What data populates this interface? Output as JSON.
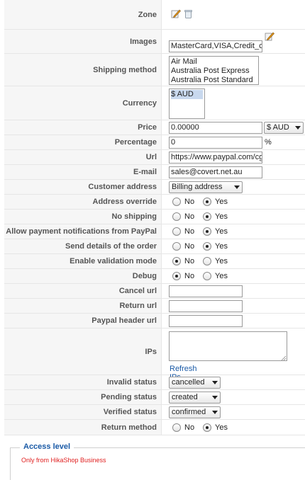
{
  "fields": {
    "zone": {
      "label": "Zone"
    },
    "images": {
      "label": "Images",
      "value": "MasterCard,VISA,Credit_card"
    },
    "shipping_method": {
      "label": "Shipping method",
      "options": [
        "Air Mail",
        "Australia Post Express",
        "Australia Post Standard"
      ]
    },
    "currency": {
      "label": "Currency",
      "options": [
        "$ AUD"
      ]
    },
    "price": {
      "label": "Price",
      "value": "0.00000",
      "currency": "$ AUD"
    },
    "percentage": {
      "label": "Percentage",
      "value": "0",
      "unit": "%"
    },
    "url": {
      "label": "Url",
      "value": "https://www.paypal.com/cgi"
    },
    "email": {
      "label": "E-mail",
      "value": "sales@covert.net.au"
    },
    "customer_address": {
      "label": "Customer address",
      "value": "Billing address"
    },
    "address_override": {
      "label": "Address override",
      "no": "No",
      "yes": "Yes"
    },
    "no_shipping": {
      "label": "No shipping",
      "no": "No",
      "yes": "Yes"
    },
    "payment_notifications": {
      "label": "Allow payment notifications from PayPal",
      "no": "No",
      "yes": "Yes"
    },
    "send_details": {
      "label": "Send details of the order",
      "no": "No",
      "yes": "Yes"
    },
    "validation_mode": {
      "label": "Enable validation mode",
      "no": "No",
      "yes": "Yes"
    },
    "debug": {
      "label": "Debug",
      "no": "No",
      "yes": "Yes"
    },
    "cancel_url": {
      "label": "Cancel url",
      "value": ""
    },
    "return_url": {
      "label": "Return url",
      "value": ""
    },
    "header_url": {
      "label": "Paypal header url",
      "value": ""
    },
    "ips": {
      "label": "IPs",
      "value": "",
      "refresh": "Refresh IPs"
    },
    "invalid_status": {
      "label": "Invalid status",
      "value": "cancelled"
    },
    "pending_status": {
      "label": "Pending status",
      "value": "created"
    },
    "verified_status": {
      "label": "Verified status",
      "value": "confirmed"
    },
    "return_method": {
      "label": "Return method",
      "no": "No",
      "yes": "Yes"
    }
  },
  "access": {
    "legend": "Access level",
    "note": "Only from HikaShop Business"
  }
}
